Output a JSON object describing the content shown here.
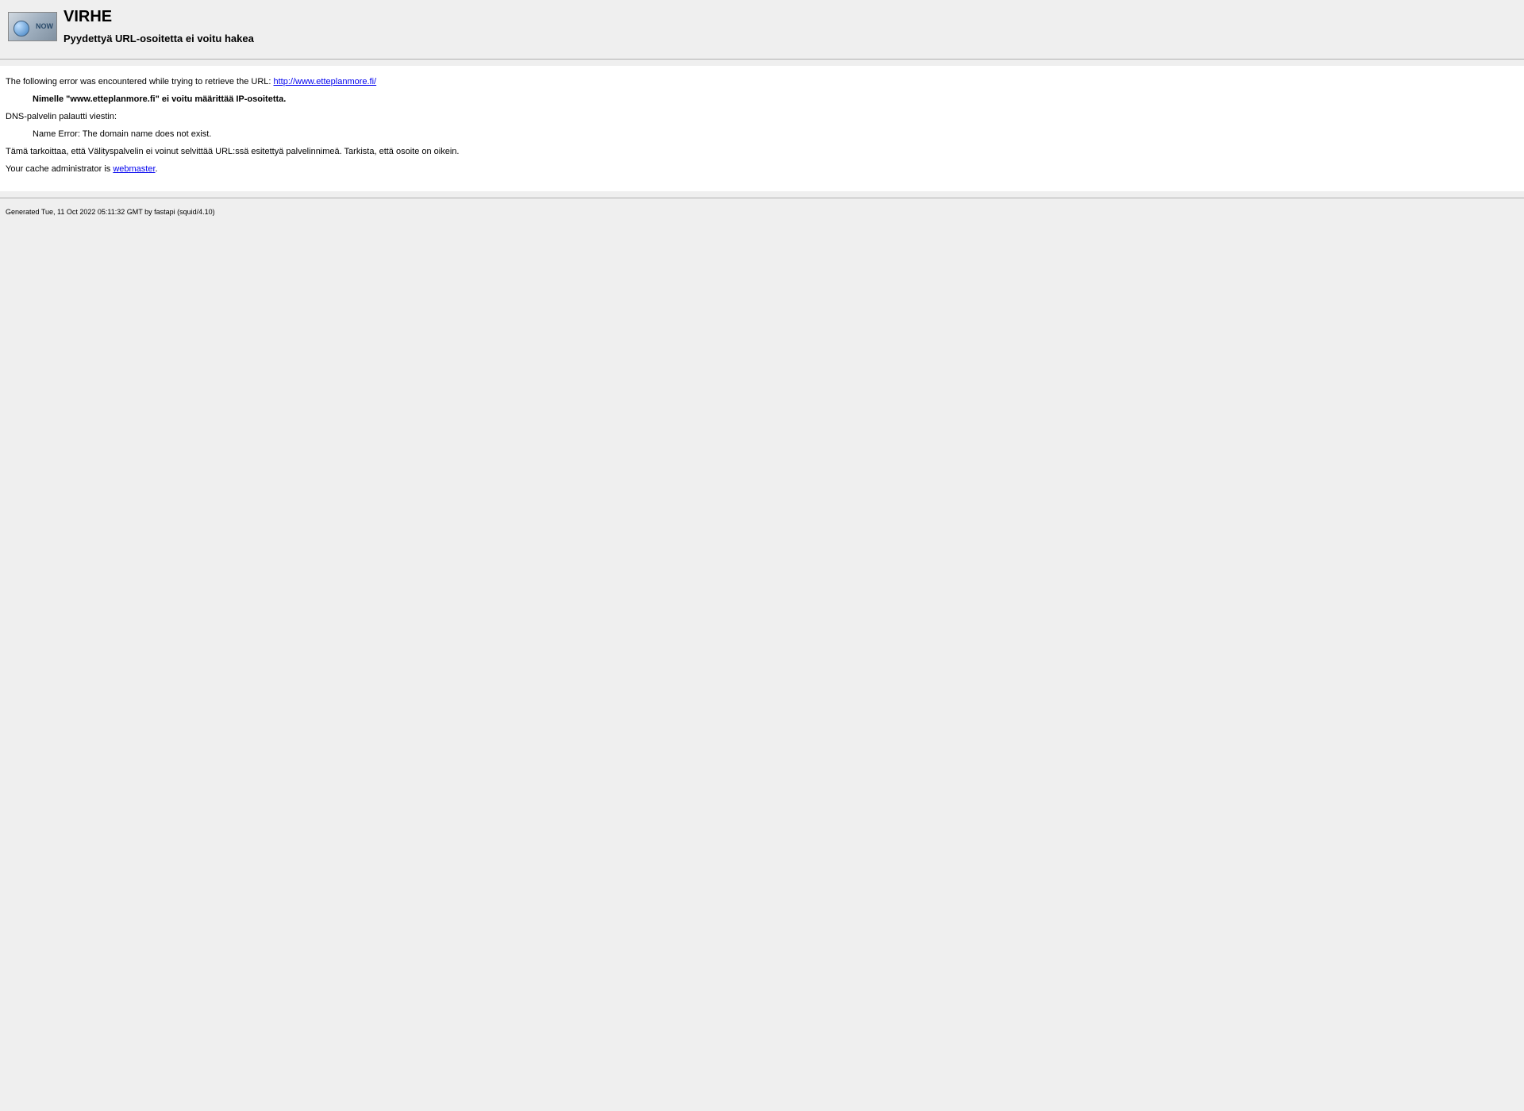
{
  "header": {
    "logo_text": "NOW",
    "title": "VIRHE",
    "subtitle": "Pyydettyä URL-osoitetta ei voitu hakea"
  },
  "content": {
    "intro_text": "The following error was encountered while trying to retrieve the URL: ",
    "url_link": "http://www.etteplanmore.fi/",
    "error_bold": "Nimelle \"www.etteplanmore.fi\" ei voitu määrittää IP-osoitetta.",
    "dns_msg_label": "DNS-palvelin palautti viestin:",
    "dns_error": "Name Error: The domain name does not exist.",
    "explanation": "Tämä tarkoittaa, että Välityspalvelin ei voinut selvittää URL:ssä esitettyä palvelinnimeä. Tarkista, että osoite on oikein.",
    "admin_prefix": "Your cache administrator is ",
    "admin_link": "webmaster",
    "admin_suffix": "."
  },
  "footer": {
    "generated": "Generated Tue, 11 Oct 2022 05:11:32 GMT by fastapi (squid/4.10)"
  }
}
